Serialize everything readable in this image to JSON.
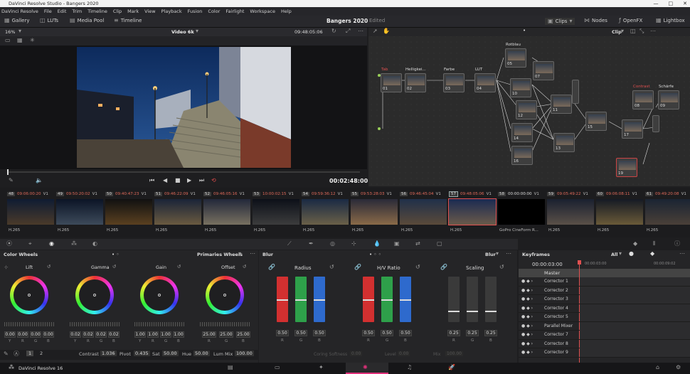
{
  "title_bar": {
    "title": "DaVinci Resolve Studio - Bangers 2020",
    "controls": [
      "—",
      "□",
      "✕"
    ]
  },
  "menu": [
    "DaVinci Resolve",
    "File",
    "Edit",
    "Trim",
    "Timeline",
    "Clip",
    "Mark",
    "View",
    "Playback",
    "Fusion",
    "Color",
    "Fairlight",
    "Workspace",
    "Help"
  ],
  "toolbar": {
    "gallery": "Gallery",
    "luts": "LUTs",
    "media_pool": "Media Pool",
    "timeline": "Timeline",
    "project": "Bangers 2020",
    "edited": "Edited",
    "clips": "Clips",
    "nodes": "Nodes",
    "openfx": "OpenFX",
    "lightbox": "Lightbox"
  },
  "viewer": {
    "zoom": "16%",
    "clip_name": "Video 6k",
    "timecode": "09:48:05:06",
    "play_timecode": "00:02:48:00"
  },
  "node_panel": {
    "mode": "Clip"
  },
  "nodes": [
    {
      "num": "01",
      "label": "Tab"
    },
    {
      "num": "02",
      "label": "Helligkei..."
    },
    {
      "num": "03",
      "label": "Farbe"
    },
    {
      "num": "04",
      "label": "LUT"
    },
    {
      "num": "05",
      "label": "Rotblau"
    },
    {
      "num": "07",
      "label": ""
    },
    {
      "num": "10",
      "label": ""
    },
    {
      "num": "11",
      "label": ""
    },
    {
      "num": "12",
      "label": ""
    },
    {
      "num": "13",
      "label": ""
    },
    {
      "num": "14",
      "label": ""
    },
    {
      "num": "15",
      "label": ""
    },
    {
      "num": "16",
      "label": ""
    },
    {
      "num": "17",
      "label": ""
    },
    {
      "num": "08",
      "label": "Contrast"
    },
    {
      "num": "09",
      "label": "Schärfe"
    },
    {
      "num": "19",
      "label": ""
    }
  ],
  "clips": [
    {
      "num": "48",
      "tc": "09:06:00:20",
      "track": "V1",
      "codec": "H.265"
    },
    {
      "num": "49",
      "tc": "09:50:20:02",
      "track": "V1",
      "codec": "H.265"
    },
    {
      "num": "50",
      "tc": "09:40:47:23",
      "track": "V1",
      "codec": "H.265"
    },
    {
      "num": "51",
      "tc": "09:46:22:09",
      "track": "V1",
      "codec": "H.265"
    },
    {
      "num": "52",
      "tc": "09:46:05:16",
      "track": "V1",
      "codec": "H.265"
    },
    {
      "num": "53",
      "tc": "10:00:02:15",
      "track": "V1",
      "codec": "H.265"
    },
    {
      "num": "54",
      "tc": "09:59:36:12",
      "track": "V1",
      "codec": "H.265"
    },
    {
      "num": "55",
      "tc": "09:53:28:03",
      "track": "V1",
      "codec": "H.265"
    },
    {
      "num": "56",
      "tc": "09:46:45:04",
      "track": "V1",
      "codec": "H.265"
    },
    {
      "num": "57",
      "tc": "09:48:05:06",
      "track": "V1",
      "codec": "H.265"
    },
    {
      "num": "58",
      "tc": "00:00:00:00",
      "track": "V1",
      "codec": "GoPro CineForm R..."
    },
    {
      "num": "59",
      "tc": "09:05:49:22",
      "track": "V1",
      "codec": "H.265"
    },
    {
      "num": "60",
      "tc": "09:06:08:11",
      "track": "V1",
      "codec": "H.265"
    },
    {
      "num": "61",
      "tc": "09:49:20:08",
      "track": "V1",
      "codec": "H.265"
    }
  ],
  "color_wheels": {
    "title": "Color Wheels",
    "mode": "Primaries Wheels",
    "wheels": [
      {
        "name": "Lift",
        "values": [
          "0.00",
          "0.00",
          "0.00",
          "0.00"
        ]
      },
      {
        "name": "Gamma",
        "values": [
          "0.02",
          "0.02",
          "0.02",
          "0.02"
        ]
      },
      {
        "name": "Gain",
        "values": [
          "1.00",
          "1.00",
          "1.00",
          "1.00"
        ]
      },
      {
        "name": "Offset",
        "values": [
          "25.00",
          "25.00",
          "25.00"
        ]
      }
    ],
    "channel_labels": [
      "Y",
      "R",
      "G",
      "B"
    ],
    "footer": {
      "page1": "1",
      "page2": "2",
      "contrast_label": "Contrast",
      "contrast": "1.036",
      "pivot_label": "Pivot",
      "pivot": "0.435",
      "sat_label": "Sat",
      "sat": "50.00",
      "hue_label": "Hue",
      "hue": "50.00",
      "lummix_label": "Lum Mix",
      "lummix": "100.00"
    }
  },
  "blur": {
    "title": "Blur",
    "mode": "Blur",
    "radius_label": "Radius",
    "hv_label": "H/V Ratio",
    "scaling_label": "Scaling",
    "radius": [
      "0.50",
      "0.50",
      "0.50"
    ],
    "hv": [
      "0.50",
      "0.50",
      "0.50"
    ],
    "scaling": [
      "0.25",
      "0.25",
      "0.25"
    ],
    "rgb": [
      "R",
      "G",
      "B"
    ],
    "coring_label": "Coring Softness",
    "coring": "0.00",
    "level_label": "Level",
    "level": "0.00",
    "mix_label": "Mix",
    "mix": "100.00"
  },
  "keyframes": {
    "title": "Keyframes",
    "filter": "All",
    "tc_start": "00:00:03:00",
    "tc_mid": "00:00:03:00",
    "tc_end": "00:00:09:02",
    "master": "Master",
    "rows": [
      "Corrector 1",
      "Corrector 2",
      "Corrector 3",
      "Corrector 4",
      "Corrector 5",
      "Parallel Mixer",
      "Corrector 7",
      "Corrector 8",
      "Corrector 9"
    ]
  },
  "status": {
    "app": "DaVinci Resolve 16"
  }
}
